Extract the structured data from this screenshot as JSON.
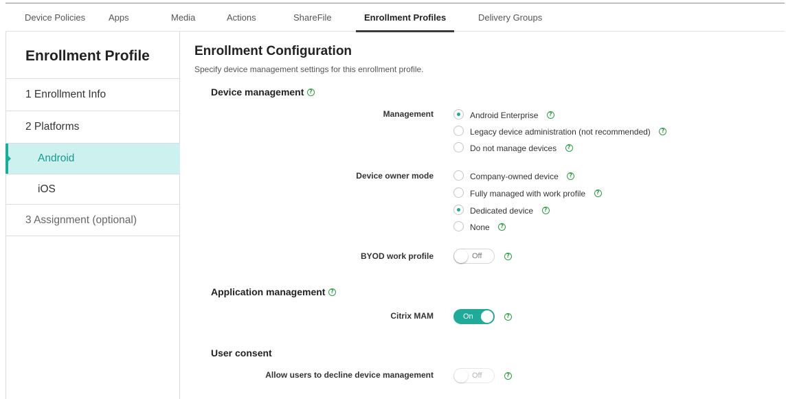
{
  "tabs": [
    {
      "label": "Device Policies"
    },
    {
      "label": "Apps"
    },
    {
      "label": "Media"
    },
    {
      "label": "Actions"
    },
    {
      "label": "ShareFile"
    },
    {
      "label": "Enrollment Profiles",
      "active": true
    },
    {
      "label": "Delivery Groups"
    }
  ],
  "sidebar": {
    "title": "Enrollment Profile",
    "items": [
      {
        "label": "1  Enrollment Info"
      },
      {
        "label": "2  Platforms"
      },
      {
        "label": "Android",
        "active": true
      },
      {
        "label": "iOS"
      },
      {
        "label": "3  Assignment (optional)"
      }
    ]
  },
  "main": {
    "title": "Enrollment Configuration",
    "subtitle": "Specify device management settings for this enrollment profile.",
    "device_management": {
      "heading": "Device management",
      "management": {
        "label": "Management",
        "options": [
          {
            "label": "Android Enterprise",
            "checked": true
          },
          {
            "label": "Legacy device administration (not recommended)",
            "checked": false
          },
          {
            "label": "Do not manage devices",
            "checked": false
          }
        ]
      },
      "owner_mode": {
        "label": "Device owner mode",
        "options": [
          {
            "label": "Company-owned device",
            "checked": false
          },
          {
            "label": "Fully managed with work profile",
            "checked": false
          },
          {
            "label": "Dedicated device",
            "checked": true
          },
          {
            "label": "None",
            "checked": false
          }
        ]
      },
      "byod": {
        "label": "BYOD work profile",
        "state": "Off"
      }
    },
    "app_management": {
      "heading": "Application management",
      "citrix_mam": {
        "label": "Citrix MAM",
        "state": "On"
      }
    },
    "user_consent": {
      "heading": "User consent",
      "decline": {
        "label": "Allow users to decline device management",
        "state": "Off"
      }
    }
  },
  "colors": {
    "accent": "#1faa9a",
    "help": "#2f9d46",
    "active_bg": "#cdf1ee"
  },
  "icons": {
    "help": "help-circle-icon"
  }
}
